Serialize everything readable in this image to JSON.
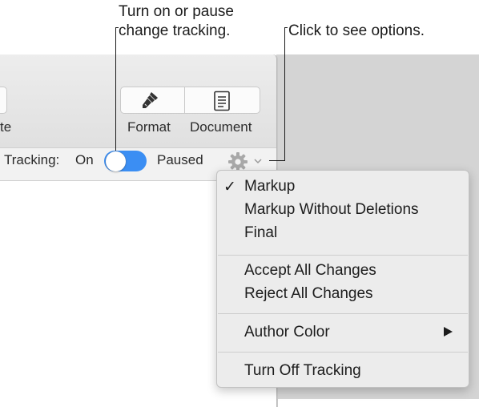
{
  "callouts": {
    "toggle": [
      "Turn on or pause",
      "change tracking."
    ],
    "options": "Click to see options."
  },
  "toolbar": {
    "left_label_fragment": "te",
    "format_label": "Format",
    "document_label": "Document"
  },
  "tracking": {
    "label": "Tracking:",
    "on_label": "On",
    "paused_label": "Paused",
    "toggle_state": "on",
    "accent_color": "#3b8ef3"
  },
  "menu": {
    "items": [
      {
        "label": "Markup",
        "checked": true
      },
      {
        "label": "Markup Without Deletions",
        "checked": false
      },
      {
        "label": "Final",
        "checked": false
      },
      {
        "label": "Accept All Changes",
        "checked": false
      },
      {
        "label": "Reject All Changes",
        "checked": false
      },
      {
        "label": "Author Color",
        "checked": false,
        "submenu": true
      },
      {
        "label": "Turn Off Tracking",
        "checked": false
      }
    ],
    "check_glyph": "✓"
  },
  "icons": [
    "format-paintbrush-icon",
    "document-icon",
    "gear-icon",
    "chevron-down-icon",
    "submenu-arrow-icon"
  ]
}
